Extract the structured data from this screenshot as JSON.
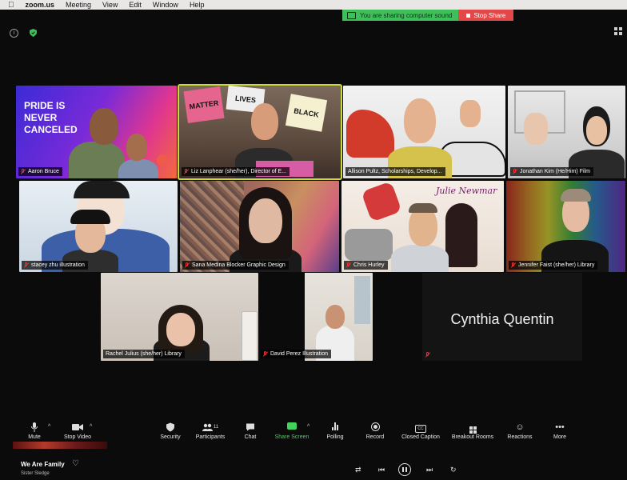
{
  "menubar": {
    "app": "zoom.us",
    "items": [
      "Meeting",
      "View",
      "Edit",
      "Window",
      "Help"
    ]
  },
  "banner": {
    "sharing_text": "You are sharing computer sound",
    "stop_label": "Stop Share"
  },
  "participants": [
    {
      "name": "Aaron Bruce",
      "muted": true
    },
    {
      "name": "Liz Lanphear (she/her), Director of E...",
      "muted": true
    },
    {
      "name": "Allison Pultz, Scholarships, Develop...",
      "muted": false
    },
    {
      "name": "Jonathan Kim (He/Him) Film",
      "muted": true
    },
    {
      "name": "stacey zhu illustration",
      "muted": true
    },
    {
      "name": "Sana Medina Blocker Graphic Design",
      "muted": true
    },
    {
      "name": "Chris Hurley",
      "muted": true
    },
    {
      "name": "Jennifer Faist (she/her) Library",
      "muted": true
    },
    {
      "name": "Rachel Julius (she/her) Library",
      "muted": false
    },
    {
      "name": "David Perez Illustration",
      "muted": true
    },
    {
      "name": "Cynthia Quentin",
      "muted": true
    }
  ],
  "tile_text": {
    "pride_sign": "PRIDE IS NEVER CANCELED",
    "protest_sign_1": "MATTER",
    "protest_sign_2": "BLACK",
    "protest_sign_3": "LIVES",
    "poster_script": "Julie Newmar"
  },
  "toolbar": {
    "mute": "Mute",
    "stop_video": "Stop Video",
    "security": "Security",
    "participants": "Participants",
    "participant_count": "11",
    "chat": "Chat",
    "share_screen": "Share Screen",
    "polling": "Polling",
    "record": "Record",
    "closed_caption": "Closed Caption",
    "cc_badge": "CC",
    "breakout_rooms": "Breakout Rooms",
    "reactions": "Reactions",
    "more": "More"
  },
  "music": {
    "title": "We Are Family",
    "artist": "Sister Sledge"
  },
  "colors": {
    "share_green": "#43d25a",
    "stop_red": "#e24848",
    "mute_red": "#e33333"
  }
}
